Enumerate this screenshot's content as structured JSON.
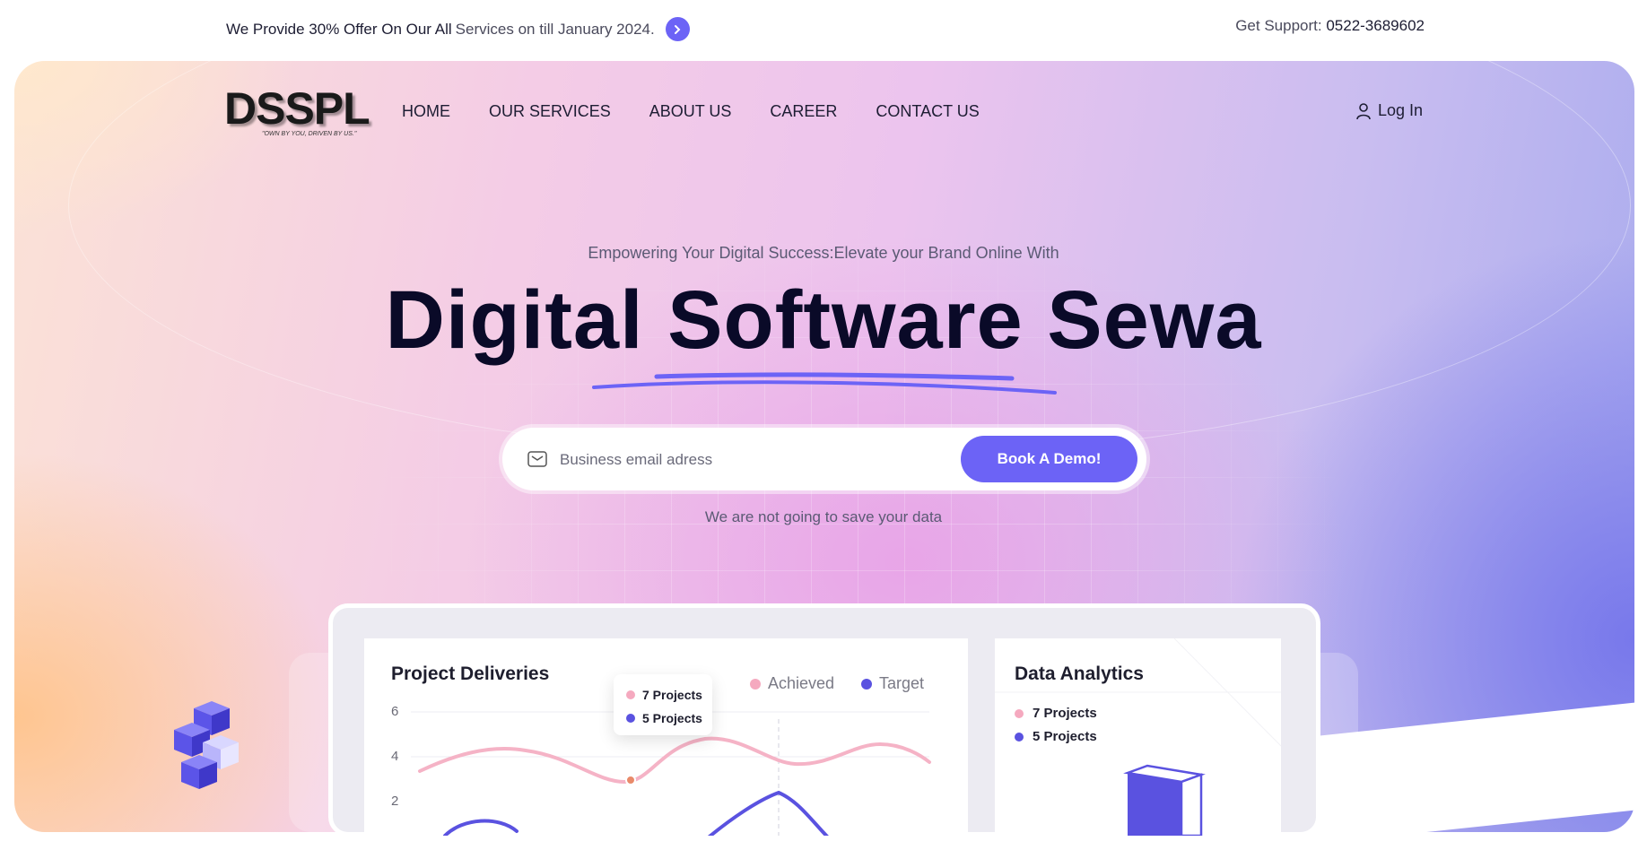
{
  "topbar": {
    "offer_main": "We Provide 30% Offer On Our All",
    "offer_rest": "Services on till January 2024.",
    "support_label": "Get Support:",
    "support_phone": "0522-3689602"
  },
  "brand": {
    "logo_text": "DSSPL",
    "tagline": "\"OWN BY YOU, DRIVEN BY US.\""
  },
  "nav": {
    "items": [
      {
        "label": "HOME"
      },
      {
        "label": "OUR SERVICES"
      },
      {
        "label": "ABOUT US"
      },
      {
        "label": "CAREER"
      },
      {
        "label": "CONTACT US"
      }
    ],
    "login_label": "Log In"
  },
  "hero": {
    "kicker": "Empowering Your Digital Success:Elevate your Brand Online With",
    "title": "Digital Software Sewa",
    "email_placeholder": "Business email adress",
    "cta_label": "Book A Demo!",
    "note": "We are not going to save your data"
  },
  "dashboard": {
    "deliveries": {
      "title": "Project Deliveries",
      "legend": [
        {
          "label": "Achieved",
          "color": "#f5a9bf"
        },
        {
          "label": "Target",
          "color": "#5a52e0"
        }
      ],
      "y_ticks": [
        "6",
        "4",
        "2"
      ],
      "tooltip": [
        {
          "label": "7 Projects",
          "color": "#f5a9bf"
        },
        {
          "label": "5 Projects",
          "color": "#5a52e0"
        }
      ]
    },
    "analytics": {
      "title": "Data Analytics",
      "rows": [
        {
          "label": "7 Projects",
          "color": "#f5a9bf"
        },
        {
          "label": "5 Projects",
          "color": "#5a52e0"
        }
      ]
    }
  },
  "colors": {
    "accent": "#6c63f6",
    "dark_text": "#0a0a28"
  }
}
